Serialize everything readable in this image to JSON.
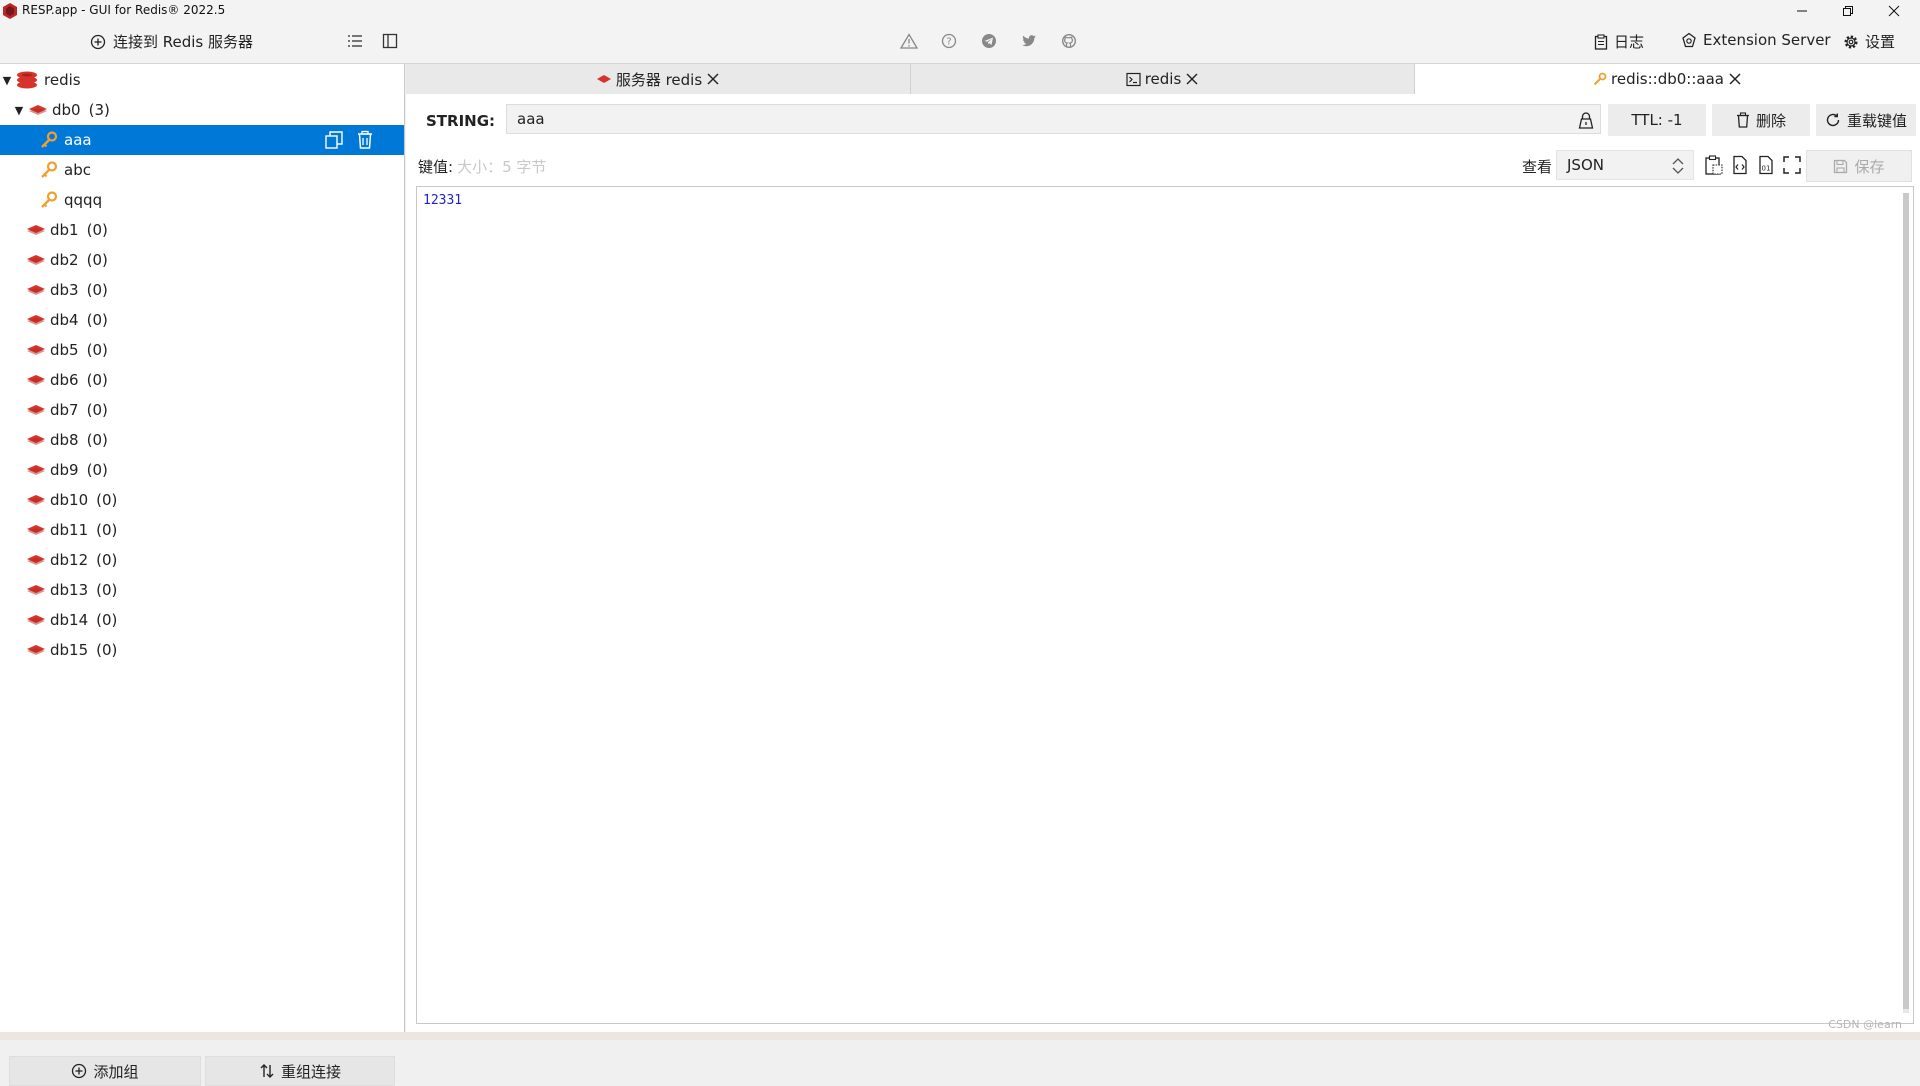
{
  "window": {
    "title": "RESP.app - GUI for Redis® 2022.5",
    "minimize_icon": "minimize-icon",
    "maximize_icon": "restore-icon",
    "close_icon": "close-icon"
  },
  "toolbar": {
    "connect_label": "连接到 Redis 服务器",
    "center_icons": [
      "warning-icon",
      "help-icon",
      "telegram-icon",
      "twitter-icon",
      "github-icon"
    ],
    "log_label": "日志",
    "extension_label": "Extension Server",
    "settings_label": "设置"
  },
  "tree": {
    "server": "redis",
    "db0": {
      "name": "db0",
      "count": "(3)"
    },
    "keys": [
      {
        "name": "aaa",
        "selected": true
      },
      {
        "name": "abc",
        "selected": false
      },
      {
        "name": "qqqq",
        "selected": false
      }
    ],
    "dbs": [
      {
        "name": "db1",
        "count": "(0)"
      },
      {
        "name": "db2",
        "count": "(0)"
      },
      {
        "name": "db3",
        "count": "(0)"
      },
      {
        "name": "db4",
        "count": "(0)"
      },
      {
        "name": "db5",
        "count": "(0)"
      },
      {
        "name": "db6",
        "count": "(0)"
      },
      {
        "name": "db7",
        "count": "(0)"
      },
      {
        "name": "db8",
        "count": "(0)"
      },
      {
        "name": "db9",
        "count": "(0)"
      },
      {
        "name": "db10",
        "count": "(0)"
      },
      {
        "name": "db11",
        "count": "(0)"
      },
      {
        "name": "db12",
        "count": "(0)"
      },
      {
        "name": "db13",
        "count": "(0)"
      },
      {
        "name": "db14",
        "count": "(0)"
      },
      {
        "name": "db15",
        "count": "(0)"
      }
    ],
    "add_group_label": "添加组",
    "regroup_label": "重组连接"
  },
  "tabs": [
    {
      "label": "服务器 redis"
    },
    {
      "label": "redis"
    },
    {
      "label": "redis::db0::aaa"
    }
  ],
  "key_view": {
    "type_label": "STRING:",
    "key_name": "aaa",
    "ttl_label": "TTL:  -1",
    "delete_label": "删除",
    "reload_label": "重载键值",
    "value_label": "键值:",
    "value_hint": "大小：5 字节",
    "view_label": "查看",
    "view_format": "JSON",
    "save_label": "保存",
    "value": "12331"
  },
  "watermark": "CSDN @learn",
  "colors": {
    "selection": "#0078d7",
    "redis_red": "#d6332a",
    "key_orange": "#f0a030",
    "value_blue": "#1e1ecf"
  }
}
